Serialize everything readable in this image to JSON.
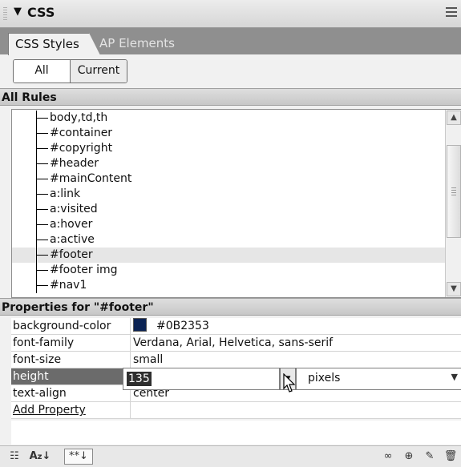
{
  "panel": {
    "title": "CSS"
  },
  "tabs": [
    {
      "label": "CSS Styles"
    },
    {
      "label": "AP Elements"
    }
  ],
  "mode_toggle": {
    "all_label": "All",
    "current_label": "Current"
  },
  "rules_section": {
    "header": "All Rules",
    "rules": [
      {
        "label": "body,td,th"
      },
      {
        "label": "#container"
      },
      {
        "label": "#copyright"
      },
      {
        "label": "#header"
      },
      {
        "label": "#mainContent"
      },
      {
        "label": "a:link"
      },
      {
        "label": "a:visited"
      },
      {
        "label": "a:hover"
      },
      {
        "label": "a:active"
      },
      {
        "label": "#footer"
      },
      {
        "label": "#footer img"
      },
      {
        "label": "#nav1"
      }
    ]
  },
  "properties_section": {
    "header": "Properties for \"#footer\"",
    "rows": [
      {
        "name": "background-color",
        "value": "#0B2353",
        "swatch_color": "#0b2353"
      },
      {
        "name": "font-family",
        "value": "Verdana, Arial, Helvetica, sans-serif"
      },
      {
        "name": "font-size",
        "value": "small"
      },
      {
        "name": "height",
        "value": ""
      },
      {
        "name": "text-align",
        "value": "center"
      }
    ],
    "add_property_label": "Add Property",
    "editor": {
      "value": "135",
      "unit": "pixels"
    }
  },
  "toolbar": {
    "icons": [
      "show-category-view-icon",
      "show-list-view-icon",
      "show-set-properties-icon",
      "attach-style-sheet-icon",
      "new-css-rule-icon",
      "edit-style-icon",
      "delete-css-rule-icon"
    ]
  }
}
